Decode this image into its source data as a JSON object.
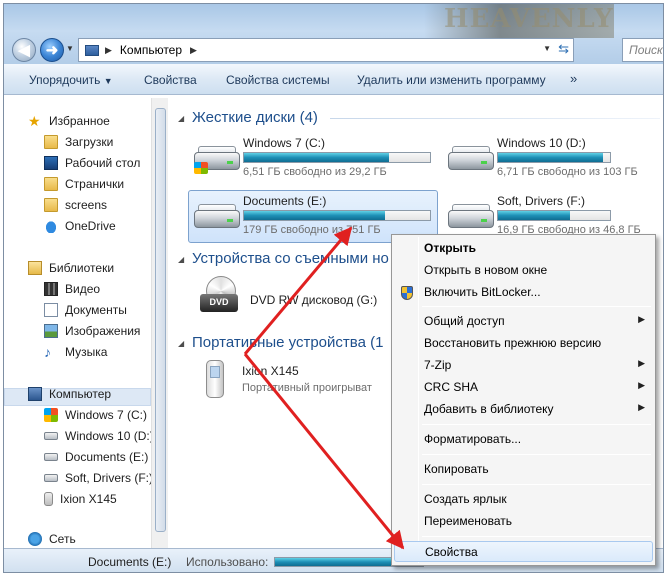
{
  "titlebar": {
    "background_text": "HEAVENLY",
    "address": {
      "location": "Компьютер"
    },
    "search_placeholder": "Поиск"
  },
  "toolbar": {
    "organize_label": "Упорядочить",
    "properties_label": "Свойства",
    "system_properties_label": "Свойства системы",
    "uninstall_label": "Удалить или изменить программу",
    "more_label": "»"
  },
  "nav": {
    "favorites": "Избранное",
    "downloads": "Загрузки",
    "desktop": "Рабочий стол",
    "pages": "Странички",
    "screens": "screens",
    "onedrive": "OneDrive",
    "libraries": "Библиотеки",
    "video": "Видео",
    "documents": "Документы",
    "images": "Изображения",
    "music": "Музыка",
    "computer": "Компьютер",
    "drive_c": "Windows 7 (C:)",
    "drive_d": "Windows 10 (D:)",
    "drive_e": "Documents (E:)",
    "drive_f": "Soft, Drivers (F:)",
    "ixion": "Ixion X145",
    "network": "Сеть"
  },
  "content": {
    "hard_drives_header": "Жесткие диски (4)",
    "removable_header": "Устройства со съемными но",
    "portable_header": "Портативные устройства (1",
    "drives": [
      {
        "name": "Windows 7 (C:)",
        "free": "6,51 ГБ свободно из 29,2 ГБ",
        "used_fraction": 0.78
      },
      {
        "name": "Windows 10 (D:)",
        "free": "6,71 ГБ свободно из 103 ГБ",
        "used_fraction": 0.94
      },
      {
        "name": "Documents (E:)",
        "free": "179 ГБ свободно из 751 ГБ",
        "used_fraction": 0.76
      },
      {
        "name": "Soft, Drivers (F:)",
        "free": "16,9 ГБ свободно из 46,8 ГБ",
        "used_fraction": 0.64
      }
    ],
    "dvd": {
      "name": "DVD RW дисковод (G:)",
      "icon_label": "DVD"
    },
    "ixion": {
      "name": "Ixion X145",
      "sub": "Портативный проигрыват"
    }
  },
  "statusbar": {
    "name": "Documents (E:)",
    "used_label": "Использовано:",
    "used_fraction": 0.76
  },
  "context_menu": {
    "open": "Открыть",
    "open_new_window": "Открыть в новом окне",
    "bitlocker": "Включить BitLocker...",
    "sharing": "Общий доступ",
    "restore": "Восстановить прежнюю версию",
    "zip": "7-Zip",
    "crc": "CRC SHA",
    "add_library": "Добавить в библиотеку",
    "format": "Форматировать...",
    "copy": "Копировать",
    "shortcut": "Создать ярлык",
    "rename": "Переименовать",
    "properties": "Свойства"
  },
  "colors": {
    "accent": "#1e4f8c",
    "annotation_arrow": "#e02020",
    "drive_fill": "#1e8fb6"
  }
}
